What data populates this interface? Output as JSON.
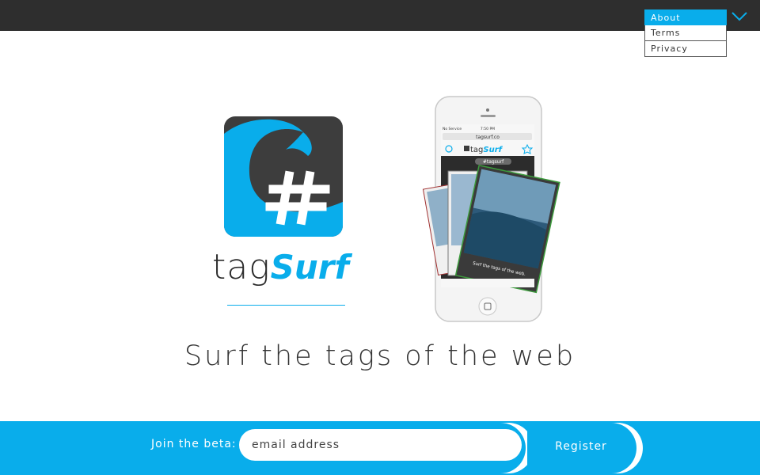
{
  "nav": {
    "items": [
      {
        "label": "About",
        "active": true
      },
      {
        "label": "Terms",
        "active": false
      },
      {
        "label": "Privacy",
        "active": false
      }
    ],
    "toggle_icon": "chevron-down-icon"
  },
  "logo": {
    "icon": "tagsurf-wave-hash-icon",
    "wordmark_part1": "tag",
    "wordmark_part2": "Surf"
  },
  "phone": {
    "carrier": "No Service",
    "time": "7:50 PM",
    "url": "tagsurf.co",
    "app_name_part1": "tag",
    "app_name_part2": "Surf",
    "hashtag": "#tagsurf",
    "card_caption": "Surf the tags of the web."
  },
  "hero": {
    "tagline": "Surf the tags of the web"
  },
  "signup": {
    "label": "Join the beta:",
    "email_placeholder": "email address",
    "button": "Register"
  },
  "colors": {
    "accent": "#09adeb",
    "topbar": "#2e2e2e",
    "logo_dark": "#3d3d3d"
  }
}
